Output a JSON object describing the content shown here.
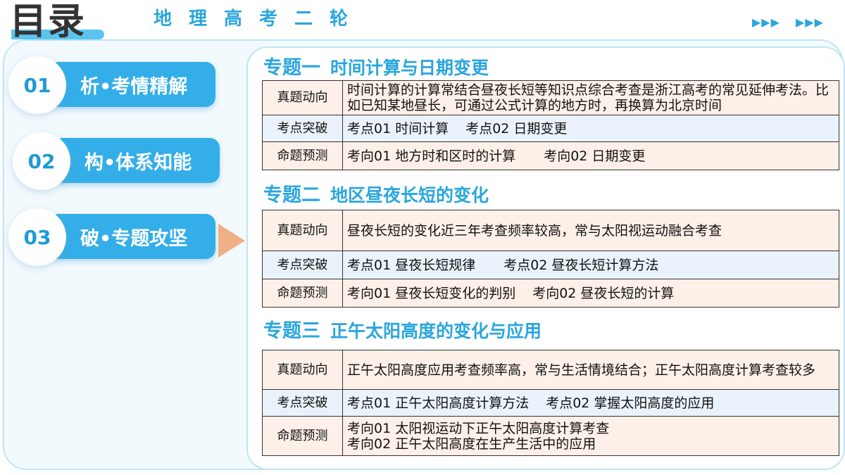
{
  "header": {
    "corner_title": "目录",
    "subject_title": "地理高考二轮",
    "arrows_left": "▶▶▶",
    "arrows_right": "▶▶▶"
  },
  "nav": [
    {
      "num": "01",
      "label": "析•考情精解"
    },
    {
      "num": "02",
      "label": "构•体系知能"
    },
    {
      "num": "03",
      "label": "破•专题攻坚"
    }
  ],
  "topics": [
    {
      "title": "专题一",
      "subtitle": "时间计算与日期变更",
      "rows": [
        {
          "label": "真题动向",
          "text": "时间计算的计算常结合昼夜长短等知识点综合考查是浙江高考的常见延伸考法。比如已知某地昼长，可通过公式计算的地方时，再换算为北京时间"
        },
        {
          "label": "考点突破",
          "a": "考点01 时间计算",
          "b": "考点02 日期变更"
        },
        {
          "label": "命题预测",
          "a": "考向01 地方时和区时的计算",
          "b": "考向02 日期变更"
        }
      ]
    },
    {
      "title": "专题二",
      "subtitle": "地区昼夜长短的变化",
      "rows": [
        {
          "label": "真题动向",
          "text": "昼夜长短的变化近三年考查频率较高，常与太阳视运动融合考查"
        },
        {
          "label": "考点突破",
          "a": "考点01 昼夜长短规律",
          "b": "考点02  昼夜长短计算方法"
        },
        {
          "label": "命题预测",
          "a": "考向01 昼夜长短变化的判别",
          "b": "考向02 昼夜长短的计算"
        }
      ]
    },
    {
      "title": "专题三",
      "subtitle": "正午太阳高度的变化与应用",
      "rows": [
        {
          "label": "真题动向",
          "text": "正午太阳高度应用考查频率高，常与生活情境结合；正午太阳高度计算考查较多"
        },
        {
          "label": "考点突破",
          "a": "考点01 正午太阳高度计算方法",
          "b": "考点02 掌握太阳高度的应用"
        },
        {
          "label": "命题预测",
          "a": "考向01 太阳视运动下正午太阳高度计算考查",
          "b": "考向02 正午太阳高度在生产生活中的应用"
        }
      ]
    }
  ]
}
